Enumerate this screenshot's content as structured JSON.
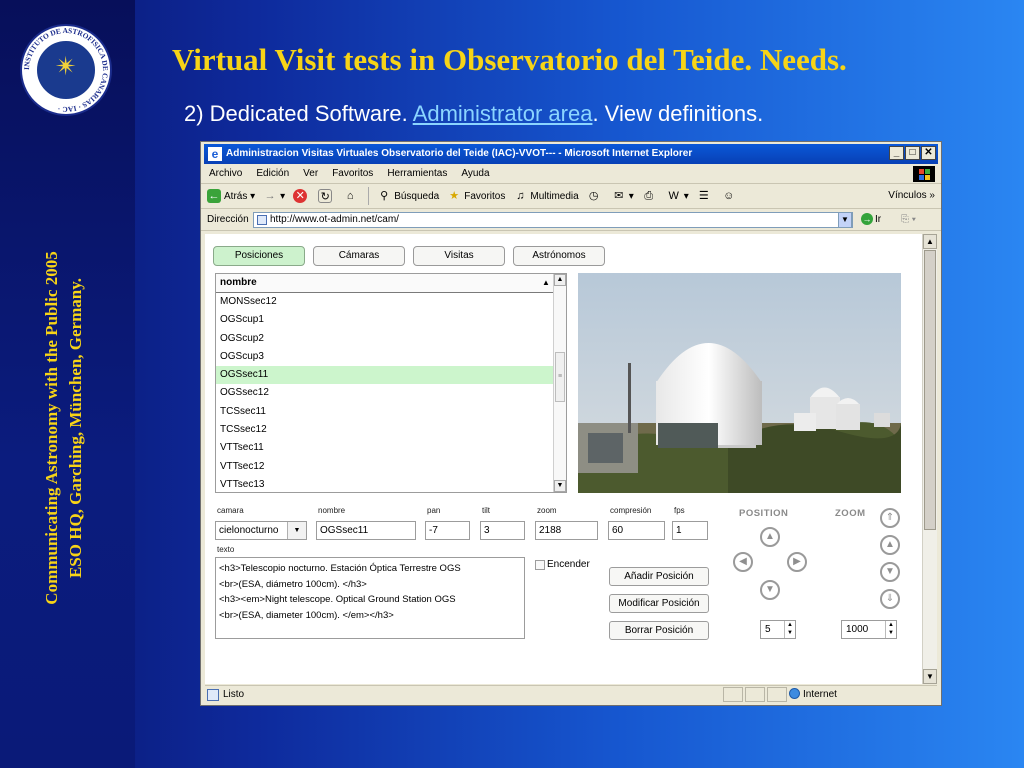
{
  "slide": {
    "title": "Virtual Visit tests in Observatorio del Teide. Needs.",
    "subtitle_prefix": "2) Dedicated Software. ",
    "subtitle_link": "Administrator area",
    "subtitle_suffix": ". View definitions.",
    "side_line1": "Communicating Astronomy with the Public 2005",
    "side_line2": "ESO HQ, Garching, München, Germany.",
    "seal_text": "INSTITUTO DE ASTROFISICA DE CANARIAS · IAC"
  },
  "browser": {
    "title": "Administracion Visitas Virtuales Observatorio del Teide (IAC)-VVOT--- - Microsoft Internet Explorer",
    "menu": [
      "Archivo",
      "Edición",
      "Ver",
      "Favoritos",
      "Herramientas",
      "Ayuda"
    ],
    "toolbar": {
      "back": "Atrás",
      "search": "Búsqueda",
      "favorites": "Favoritos",
      "media": "Multimedia",
      "links": "Vínculos"
    },
    "address_label": "Dirección",
    "address": "http://www.ot-admin.net/cam/",
    "go": "Ir",
    "status": "Listo",
    "zone": "Internet"
  },
  "app": {
    "tabs": [
      "Posiciones",
      "Cámaras",
      "Visitas",
      "Astrónomos"
    ],
    "active_tab": "Posiciones",
    "list_header": "nombre",
    "list_items": [
      "MONSsec12",
      "OGScup1",
      "OGScup2",
      "OGScup3",
      "OGSsec11",
      "OGSsec12",
      "TCSsec11",
      "TCSsec12",
      "VTTsec11",
      "VTTsec12",
      "VTTsec13"
    ],
    "selected_item": "OGSsec11",
    "fields": {
      "camara_label": "camara",
      "camara": "cielonocturno",
      "nombre_label": "nombre",
      "nombre": "OGSsec11",
      "pan_label": "pan",
      "pan": "-7",
      "tilt_label": "tilt",
      "tilt": "3",
      "zoom_label": "zoom",
      "zoom": "2188",
      "compresion_label": "compresión",
      "compresion": "60",
      "fps_label": "fps",
      "fps": "1",
      "texto_label": "texto"
    },
    "texto_lines": [
      "<h3>Telescopio nocturno. Estación Óptica Terrestre OGS",
      "<br>(ESA, diámetro 100cm). </h3>",
      "<h3><em>Night telescope. Optical Ground Station OGS",
      "<br>(ESA, diameter 100cm). </em></h3>"
    ],
    "encender": "Encender",
    "buttons": {
      "add": "Añadir Posición",
      "modify": "Modificar Posición",
      "delete": "Borrar Posición"
    },
    "position_label": "POSITION",
    "zoom_label": "ZOOM",
    "step_value": "5",
    "zoom_step_value": "1000"
  },
  "colors": {
    "title": "#f7d417",
    "link": "#8bd5ff",
    "selected_row": "#ccf5cc"
  }
}
